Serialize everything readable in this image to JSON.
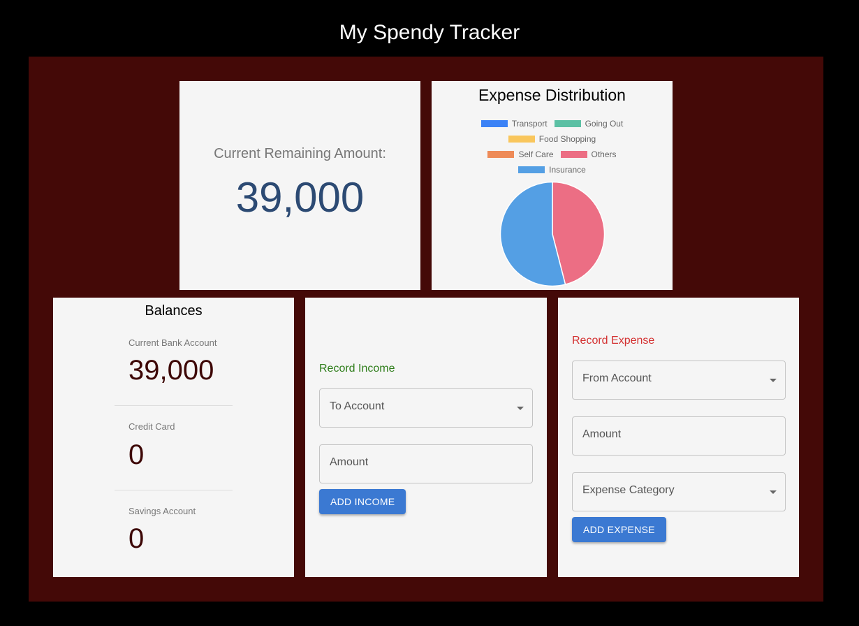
{
  "app": {
    "title": "My Spendy Tracker"
  },
  "remaining": {
    "label": "Current Remaining Amount:",
    "value": "39,000"
  },
  "chart": {
    "title": "Expense Distribution",
    "legend": [
      {
        "label": "Transport",
        "color": "#3b82f6"
      },
      {
        "label": "Going Out",
        "color": "#5bc0a4"
      },
      {
        "label": "Food Shopping",
        "color": "#f9c65c"
      },
      {
        "label": "Self Care",
        "color": "#ee8b58"
      },
      {
        "label": "Others",
        "color": "#ec6e84"
      },
      {
        "label": "Insurance",
        "color": "#549fe4"
      }
    ]
  },
  "chart_data": {
    "type": "pie",
    "title": "Expense Distribution",
    "labels": [
      "Transport",
      "Going Out",
      "Food Shopping",
      "Self Care",
      "Others",
      "Insurance"
    ],
    "values": [
      0,
      0,
      0,
      0,
      46,
      54
    ],
    "colors": [
      "#3b82f6",
      "#5bc0a4",
      "#f9c65c",
      "#ee8b58",
      "#ec6e84",
      "#549fe4"
    ],
    "legend_position": "top"
  },
  "balances": {
    "title": "Balances",
    "accounts": [
      {
        "label": "Current Bank Account",
        "value": "39,000"
      },
      {
        "label": "Credit Card",
        "value": "0"
      },
      {
        "label": "Savings Account",
        "value": "0"
      }
    ]
  },
  "income": {
    "heading": "Record Income",
    "heading_color": "#2e7d1a",
    "account_placeholder": "To Account",
    "amount_placeholder": "Amount",
    "button": "ADD INCOME"
  },
  "expense": {
    "heading": "Record Expense",
    "heading_color": "#d32f2f",
    "account_placeholder": "From Account",
    "amount_placeholder": "Amount",
    "category_placeholder": "Expense Category",
    "button": "ADD EXPENSE"
  }
}
